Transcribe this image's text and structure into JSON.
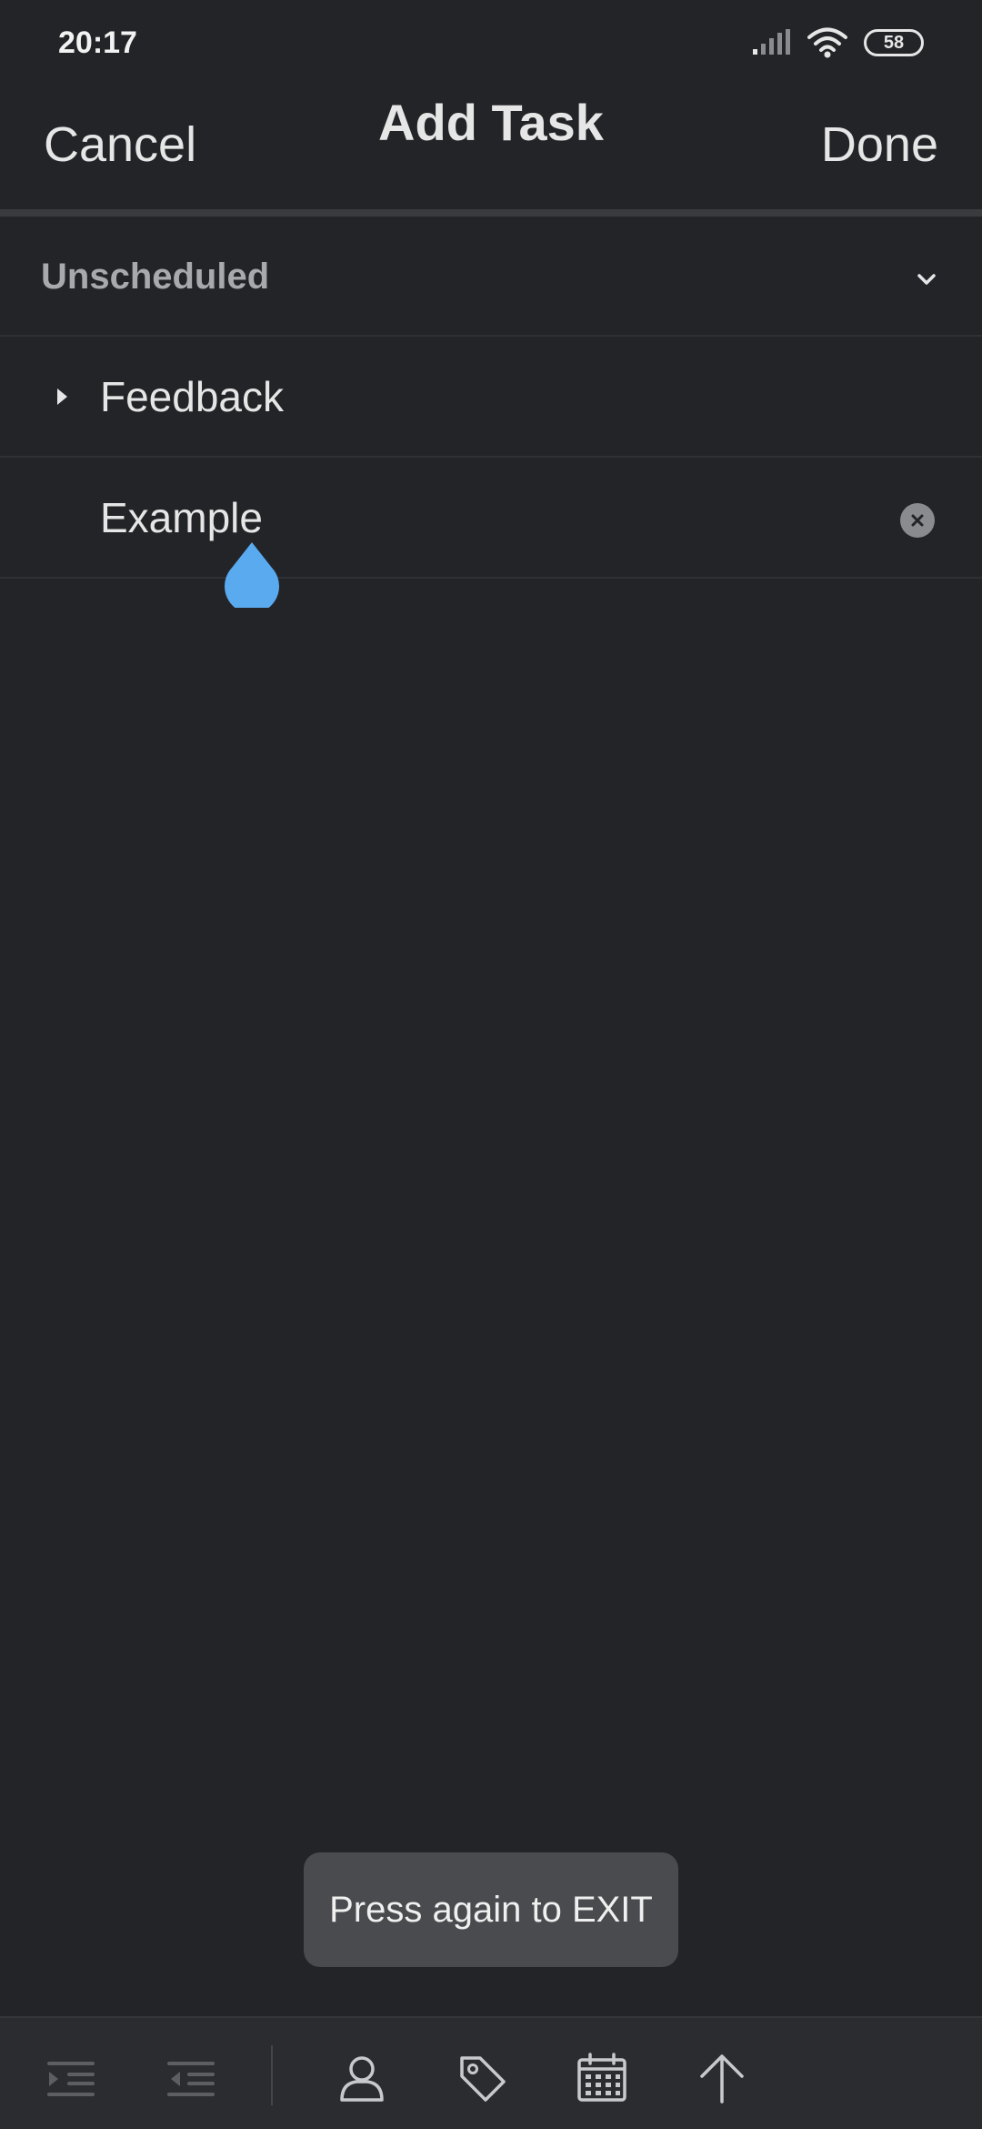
{
  "status_bar": {
    "time": "20:17",
    "battery": "58",
    "icons": [
      "signal-icon",
      "wifi-icon",
      "battery-icon"
    ]
  },
  "header": {
    "cancel_label": "Cancel",
    "title": "Add Task",
    "done_label": "Done"
  },
  "schedule": {
    "label": "Unscheduled",
    "icon": "chevron-down-icon"
  },
  "project": {
    "label": "Feedback",
    "icon": "caret-right-icon"
  },
  "task": {
    "value": "Example",
    "clear_icon": "clear-icon"
  },
  "toast": {
    "message": "Press again to EXIT"
  },
  "toolbar": {
    "icons": [
      "indent-icon",
      "outdent-icon",
      "assignee-icon",
      "tag-icon",
      "calendar-icon",
      "priority-up-icon"
    ]
  },
  "colors": {
    "background": "#232428",
    "toolbar": "#2b2c30",
    "cursor_handle": "#5aaaf0",
    "toast": "#4a4b4e"
  }
}
